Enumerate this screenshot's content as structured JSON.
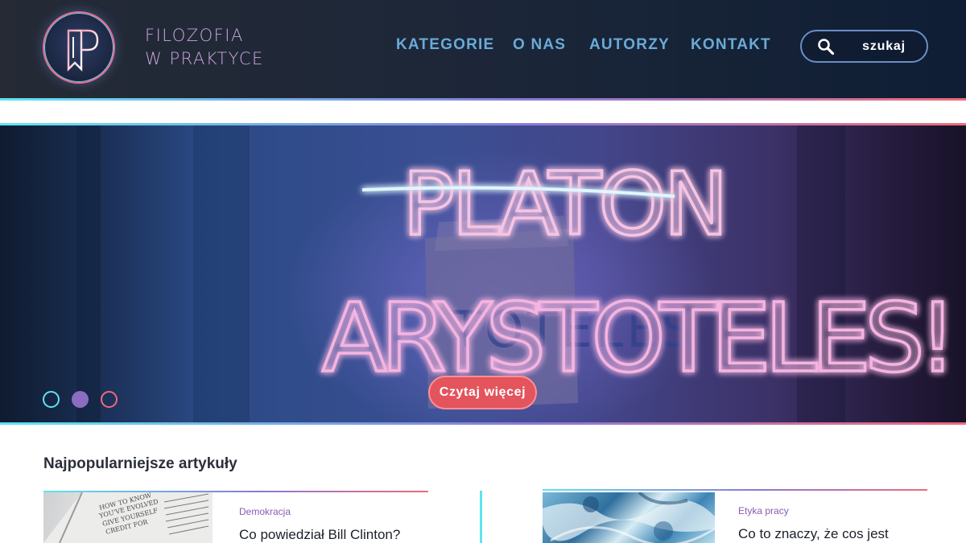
{
  "brand": {
    "logo_line1": "Filozofia",
    "logo_line2": "W praktyce",
    "logo_icon": "bookmark-fp-monogram-icon"
  },
  "nav": {
    "items": [
      {
        "label": "KATEGORIE"
      },
      {
        "label": "O NAS"
      },
      {
        "label": "AUTORZY"
      },
      {
        "label": "KONTAKT"
      }
    ]
  },
  "search": {
    "placeholder": "szukaj",
    "icon": "search-icon"
  },
  "hero": {
    "neon_word_1": "PLATON",
    "neon_word_2": "ARYSTOTELES!",
    "cta_label": "Czytaj więcej",
    "slides_total": 3,
    "active_slide": 1
  },
  "popular": {
    "title": "Najpopularniejsze artykuły",
    "articles": [
      {
        "category": "Demokracja",
        "title": "Co powiedział Bill Clinton?"
      },
      {
        "category": "Etyka pracy",
        "title": "Co to znaczy, że cos jest"
      }
    ]
  },
  "colors": {
    "accent_cyan": "#5fe3f0",
    "accent_purple": "#8a7ad8",
    "accent_red": "#ef6a7a",
    "cta": "#e3545d",
    "nav_text": "#6aaad8"
  }
}
